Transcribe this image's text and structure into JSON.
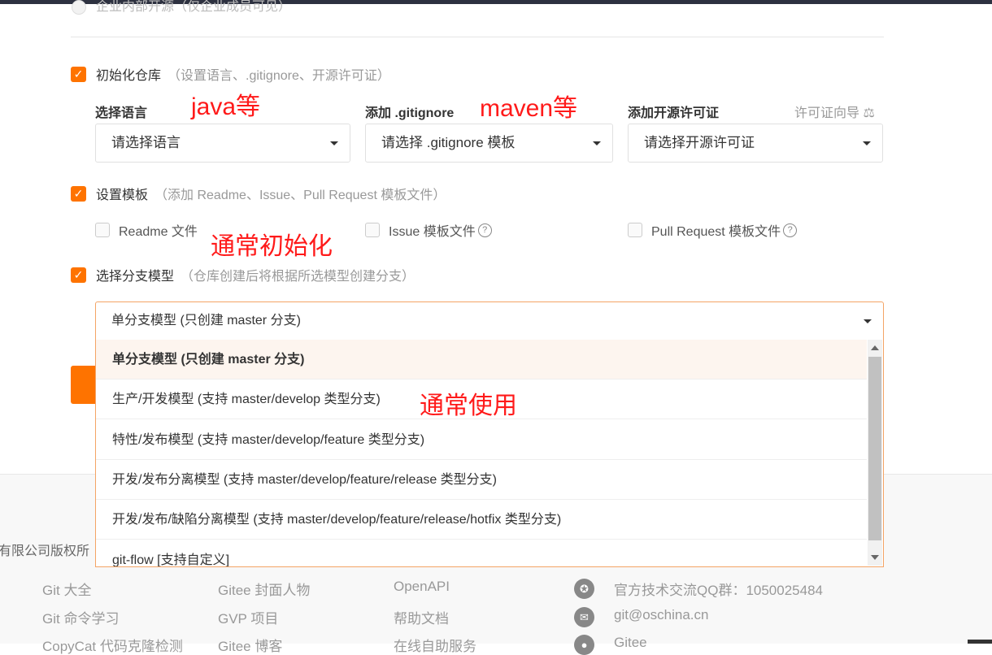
{
  "top_cut_text": "企业内部开源（仅企业成员可见）",
  "init_repo": {
    "label": "初始化仓库",
    "hint": "（设置语言、.gitignore、开源许可证）",
    "language": {
      "label": "选择语言",
      "placeholder": "请选择语言"
    },
    "gitignore": {
      "label": "添加 .gitignore",
      "placeholder": "请选择 .gitignore 模板"
    },
    "license": {
      "label": "添加开源许可证",
      "placeholder": "请选择开源许可证",
      "wizard": "许可证向导"
    }
  },
  "template": {
    "label": "设置模板",
    "hint": "（添加 Readme、Issue、Pull Request 模板文件）",
    "readme": "Readme 文件",
    "issue": "Issue 模板文件",
    "pr": "Pull Request 模板文件"
  },
  "branch": {
    "label": "选择分支模型",
    "hint": "（仓库创建后将根据所选模型创建分支）",
    "selected": "单分支模型 (只创建 master 分支)",
    "options": [
      "单分支模型 (只创建 master 分支)",
      "生产/开发模型 (支持 master/develop 类型分支)",
      "特性/发布模型 (支持 master/develop/feature 类型分支)",
      "开发/发布分离模型 (支持 master/develop/feature/release 类型分支)",
      "开发/发布/缺陷分离模型 (支持 master/develop/feature/release/hotfix 类型分支)",
      "git-flow [支持自定义]"
    ]
  },
  "annotations": {
    "java": "java等",
    "maven": "maven等",
    "init_usually": "通常初始化",
    "usually_use": "通常使用"
  },
  "footer": {
    "copyright": "有限公司版权所",
    "col1": [
      "Git 大全",
      "Git 命令学习",
      "CopyCat 代码克隆检测"
    ],
    "col2": [
      "Gitee 封面人物",
      "GVP 项目",
      "Gitee 博客"
    ],
    "col3": [
      "OpenAPI",
      "帮助文档",
      "在线自助服务"
    ],
    "contact": {
      "qq": "官方技术交流QQ群：1050025484",
      "email": "git@oschina.cn",
      "weibo": "Gitee"
    }
  },
  "colors": {
    "accent": "#fe7300",
    "annotation": "#ff1a1a"
  }
}
